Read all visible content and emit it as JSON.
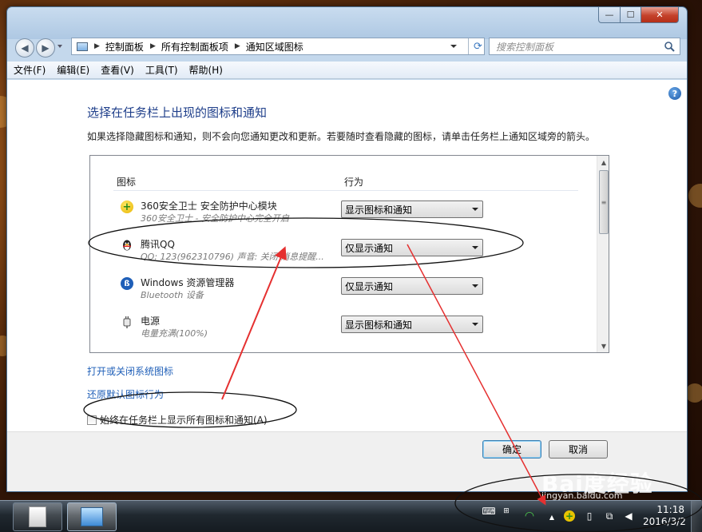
{
  "window": {
    "controls": {
      "minimize": "—",
      "maximize": "☐",
      "close": "✕"
    },
    "breadcrumb": [
      "控制面板",
      "所有控制面板项",
      "通知区域图标"
    ],
    "search_placeholder": "搜索控制面板"
  },
  "menu": [
    "文件(F)",
    "编辑(E)",
    "查看(V)",
    "工具(T)",
    "帮助(H)"
  ],
  "main": {
    "heading": "选择在任务栏上出现的图标和通知",
    "description": "如果选择隐藏图标和通知，则不会向您通知更改和更新。若要随时查看隐藏的图标，请单击任务栏上通知区域旁的箭头。",
    "columns": {
      "icon": "图标",
      "behavior": "行为"
    },
    "rows": [
      {
        "name": "360安全卫士 安全防护中心模块",
        "subtitle": "360安全卫士 - 安全防护中心完全开启",
        "behavior": "显示图标和通知",
        "icon": "360-icon"
      },
      {
        "name": "腾讯QQ",
        "subtitle": "QQ: 123(962310796)  声音: 关闭  消息提醒...",
        "behavior": "仅显示通知",
        "icon": "qq-penguin-icon"
      },
      {
        "name": "Windows 资源管理器",
        "subtitle": "Bluetooth 设备",
        "behavior": "仅显示通知",
        "icon": "bluetooth-icon"
      },
      {
        "name": "电源",
        "subtitle": "电量充满(100%)",
        "behavior": "显示图标和通知",
        "icon": "power-plug-icon"
      }
    ],
    "links": {
      "system_icons": "打开或关闭系统图标",
      "restore_default": "还原默认图标行为"
    },
    "checkbox_label": "始终在任务栏上显示所有图标和通知(A)",
    "checkbox_checked": false
  },
  "buttons": {
    "ok": "确定",
    "cancel": "取消"
  },
  "taskbar": {
    "time": "11:18",
    "date": "2016/3/2"
  },
  "watermark": {
    "logo": "Bai度经验",
    "url": "jingyan.baidu.com"
  },
  "colors": {
    "heading": "#1e3e8a",
    "link": "#1f5fb8",
    "annotation": "#e53030"
  }
}
